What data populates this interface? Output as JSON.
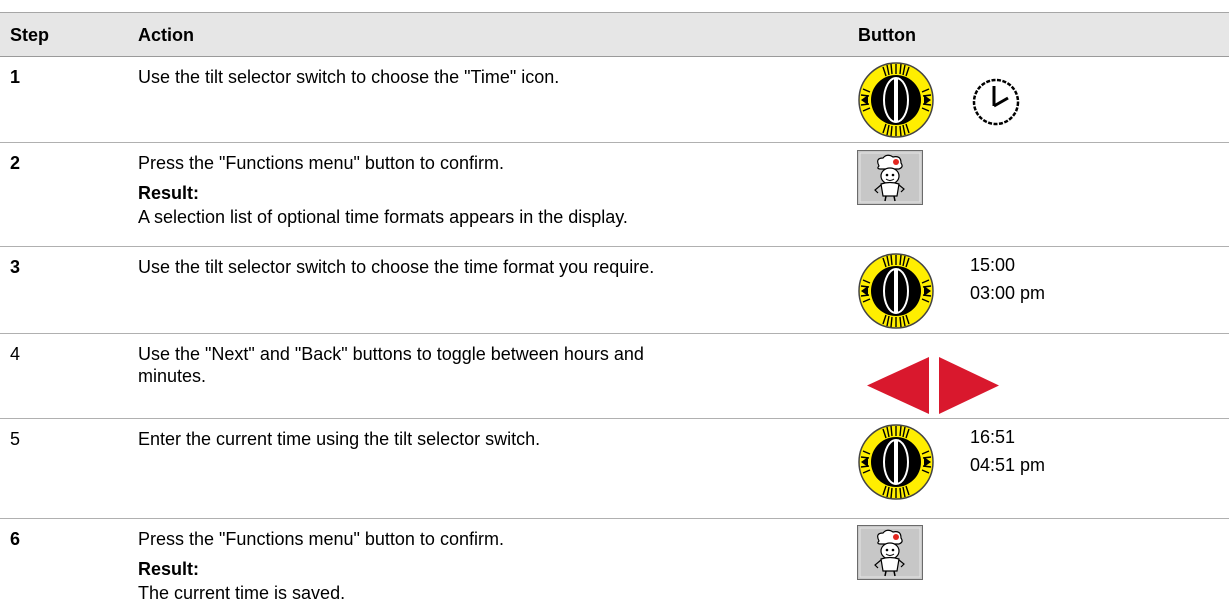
{
  "header": {
    "step": "Step",
    "action": "Action",
    "button": "Button"
  },
  "rows": [
    {
      "step": "1",
      "action": "Use the tilt selector switch to choose the \"Time\" icon."
    },
    {
      "step": "2",
      "action": "Press the \"Functions menu\" button to confirm.",
      "result_label": "Result:",
      "result": "A selection list of optional time formats appears in the display."
    },
    {
      "step": "3",
      "action": "Use the tilt selector switch to choose the time format you require.",
      "times": [
        "15:00",
        "03:00 pm"
      ]
    },
    {
      "step": "4",
      "action_lines": [
        "Use the \"Next\" and \"Back\" buttons to toggle between hours and",
        "minutes."
      ]
    },
    {
      "step": "5",
      "action": "Enter the current time using the tilt selector switch.",
      "times": [
        "16:51",
        "04:51 pm"
      ]
    },
    {
      "step": "6",
      "action": "Press the \"Functions menu\" button to confirm.",
      "result_label": "Result:",
      "result": "The current time is saved."
    }
  ],
  "colors": {
    "header_bg": "#e6e6e6",
    "dial_yellow": "#ffee00",
    "arrow_red": "#d9182d"
  },
  "icons": {
    "dial": "tilt-selector-dial-icon",
    "clock": "clock-icon",
    "functions": "chef-functions-icon",
    "back": "back-arrow-icon",
    "next": "next-arrow-icon"
  }
}
